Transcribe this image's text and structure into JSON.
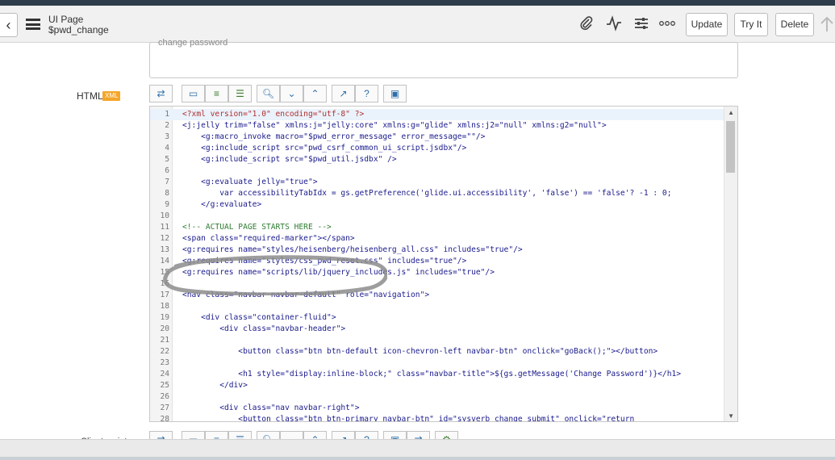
{
  "header": {
    "title": "UI Page",
    "subtitle": "$pwd_change",
    "buttons": {
      "update": "Update",
      "try_it": "Try It",
      "delete": "Delete"
    }
  },
  "form": {
    "description_value": "change password",
    "html_label": "HTML",
    "html_badge": "XML",
    "client_script_label": "Client script"
  },
  "editor": {
    "lines": [
      {
        "n": "1",
        "code": "<?xml version=\"1.0\" encoding=\"utf-8\" ?>"
      },
      {
        "n": "2",
        "code": "<j:jelly trim=\"false\" xmlns:j=\"jelly:core\" xmlns:g=\"glide\" xmlns:j2=\"null\" xmlns:g2=\"null\">"
      },
      {
        "n": "3",
        "code": "    <g:macro_invoke macro=\"$pwd_error_message\" error_message=\"\"/>"
      },
      {
        "n": "4",
        "code": "    <g:include_script src=\"pwd_csrf_common_ui_script.jsdbx\"/>"
      },
      {
        "n": "5",
        "code": "    <g:include_script src=\"$pwd_util.jsdbx\" />"
      },
      {
        "n": "6",
        "code": ""
      },
      {
        "n": "7",
        "code": "    <g:evaluate jelly=\"true\">"
      },
      {
        "n": "8",
        "code": "        var accessibilityTabIdx = gs.getPreference('glide.ui.accessibility', 'false') == 'false'? -1 : 0;"
      },
      {
        "n": "9",
        "code": "    </g:evaluate>"
      },
      {
        "n": "10",
        "code": ""
      },
      {
        "n": "11",
        "code": "<!-- ACTUAL PAGE STARTS HERE -->"
      },
      {
        "n": "12",
        "code": "<span class=\"required-marker\"></span>"
      },
      {
        "n": "13",
        "code": "<g:requires name=\"styles/heisenberg/heisenberg_all.css\" includes=\"true\"/>"
      },
      {
        "n": "14",
        "code": "<g:requires name=\"styles/css_pwd_reset.css\" includes=\"true\"/>"
      },
      {
        "n": "15",
        "code": "<g:requires name=\"scripts/lib/jquery_includes.js\" includes=\"true\"/>"
      },
      {
        "n": "16",
        "code": ""
      },
      {
        "n": "17",
        "code": "<nav class=\"navbar navbar-default\" role=\"navigation\">"
      },
      {
        "n": "18",
        "code": ""
      },
      {
        "n": "19",
        "code": "    <div class=\"container-fluid\">"
      },
      {
        "n": "20",
        "code": "        <div class=\"navbar-header\">"
      },
      {
        "n": "21",
        "code": ""
      },
      {
        "n": "22",
        "code": "            <button class=\"btn btn-default icon-chevron-left navbar-btn\" onclick=\"goBack();\"></button>"
      },
      {
        "n": "23",
        "code": ""
      },
      {
        "n": "24",
        "code": "            <h1 style=\"display:inline-block;\" class=\"navbar-title\">${gs.getMessage('Change Password')}</h1>"
      },
      {
        "n": "25",
        "code": "        </div>"
      },
      {
        "n": "26",
        "code": ""
      },
      {
        "n": "27",
        "code": "        <div class=\"nav navbar-right\">"
      },
      {
        "n": "28",
        "code": "            <button class=\"btn btn-primary navbar-btn\" id=\"sysverb_change_submit\" onclick=\"return"
      }
    ]
  },
  "icons": {
    "back": "chevron-left-icon",
    "menu": "hamburger-menu-icon",
    "attach": "paperclip-icon",
    "activity": "activity-pulse-icon",
    "settings": "sliders-icon",
    "more": "more-options-icon",
    "scroll_top": "arrow-up-icon"
  }
}
